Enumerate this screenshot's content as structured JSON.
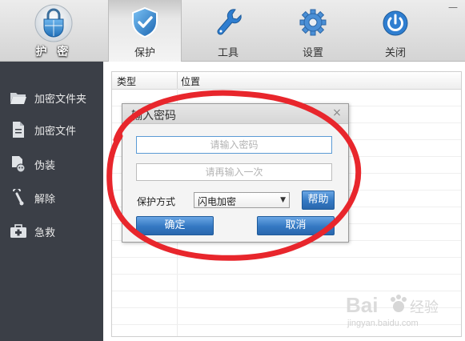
{
  "header": {
    "brand_label": "护 密",
    "tabs": [
      {
        "id": "protect",
        "label": "保护",
        "icon": "shield-icon",
        "active": true
      },
      {
        "id": "tools",
        "label": "工具",
        "icon": "wrench-icon",
        "active": false
      },
      {
        "id": "settings",
        "label": "设置",
        "icon": "gear-icon",
        "active": false
      },
      {
        "id": "close",
        "label": "关闭",
        "icon": "power-icon",
        "active": false
      }
    ],
    "minimize_glyph": "—"
  },
  "sidebar": {
    "items": [
      {
        "label": "加密文件夹",
        "icon": "folder-icon"
      },
      {
        "label": "加密文件",
        "icon": "file-icon"
      },
      {
        "label": "伪装",
        "icon": "disguise-icon"
      },
      {
        "label": "解除",
        "icon": "unlock-icon"
      },
      {
        "label": "急救",
        "icon": "first-aid-icon"
      }
    ]
  },
  "table": {
    "columns": [
      "类型",
      "位置"
    ]
  },
  "dialog": {
    "title": "输入密码",
    "close_glyph": "×",
    "password_placeholder": "请输入密码",
    "confirm_placeholder": "请再输入一次",
    "mode_label": "保护方式",
    "mode_value": "闪电加密",
    "help_label": "帮助",
    "ok_label": "确定",
    "cancel_label": "取消"
  },
  "annotation": {
    "color": "#e8262c"
  },
  "watermark": {
    "brand_text": "Bai",
    "brand_suffix": "经验",
    "url": "jingyan.baidu.com"
  },
  "colors": {
    "sidebar_bg": "#3b3f47",
    "button_blue": "#3478c2",
    "focus_border": "#5b9bd5"
  }
}
